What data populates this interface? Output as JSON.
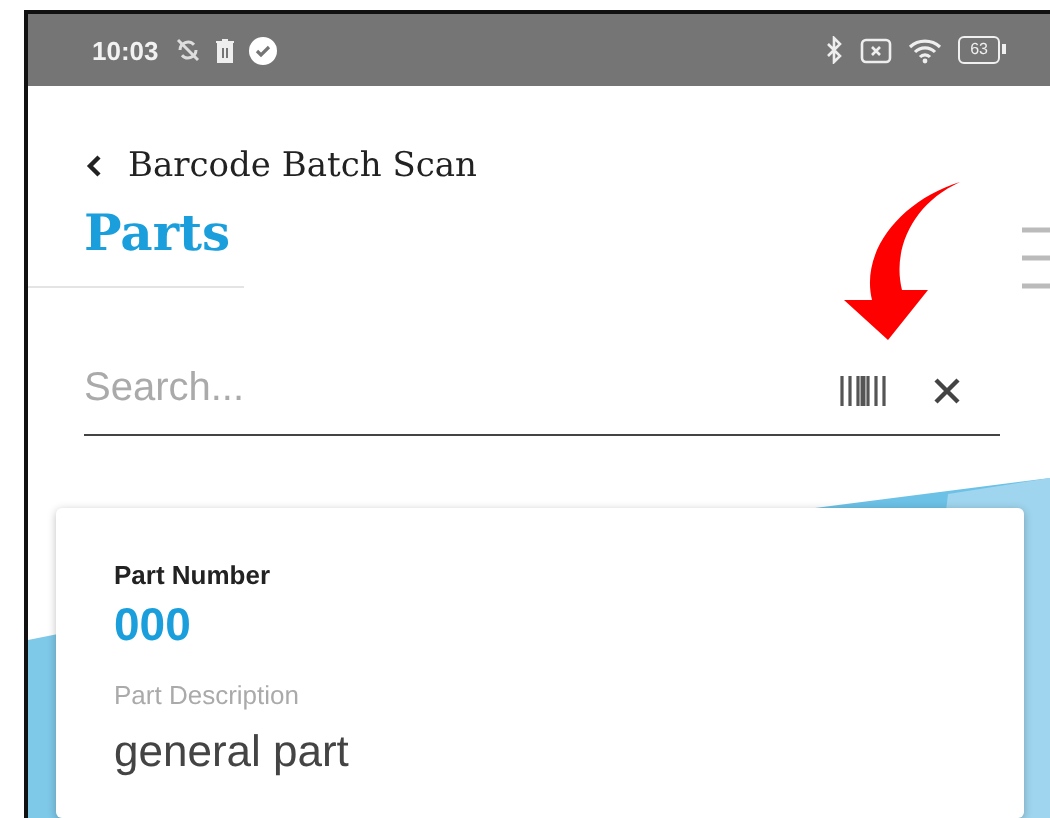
{
  "status_bar": {
    "time": "10:03",
    "battery": "63"
  },
  "header": {
    "back_title": "Barcode Batch Scan",
    "title": "Parts"
  },
  "search": {
    "placeholder": "Search..."
  },
  "card": {
    "fields": [
      {
        "label": "Part Number",
        "value": "000",
        "kind": "primary"
      },
      {
        "label": "Part Description",
        "value": "general part",
        "kind": "secondary"
      }
    ]
  }
}
